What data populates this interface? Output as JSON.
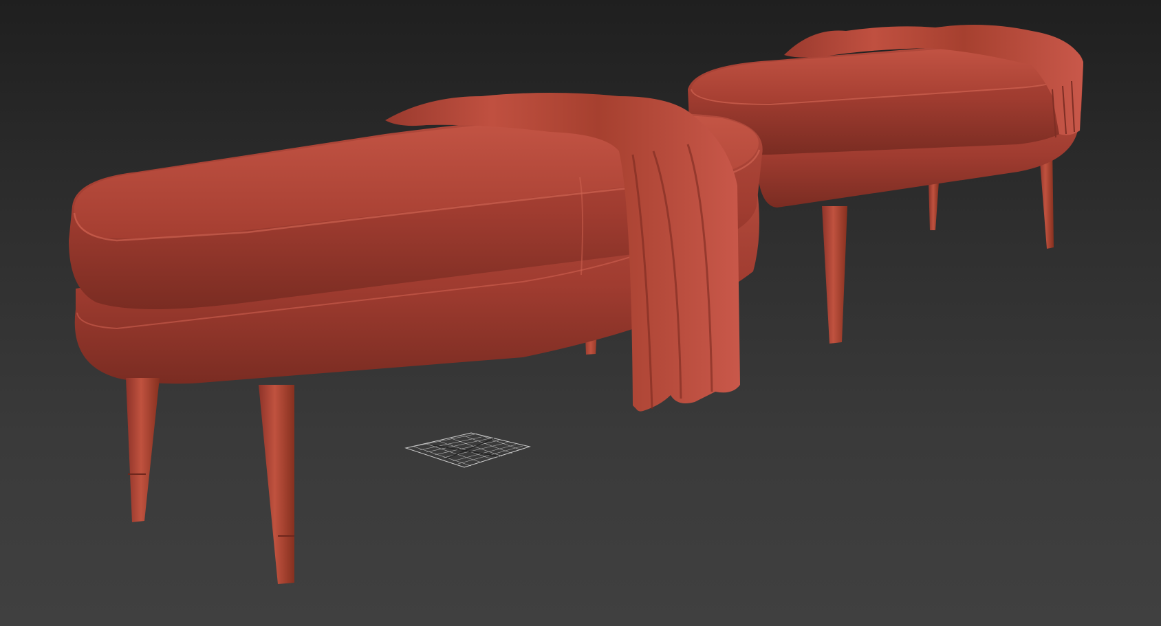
{
  "viewport": {
    "label": "",
    "render_mode": "clay",
    "background_top": "#1f1f1f",
    "background_bottom": "#404040"
  },
  "scene": {
    "objects": [
      {
        "name": "bench-front",
        "material_color": "#b34838"
      },
      {
        "name": "bench-back",
        "material_color": "#b34838"
      },
      {
        "name": "throw-blanket-front",
        "material_color": "#b0443a"
      },
      {
        "name": "throw-blanket-back",
        "material_color": "#b0443a"
      }
    ],
    "grid_gizmo_color": "#cfcfcf"
  }
}
